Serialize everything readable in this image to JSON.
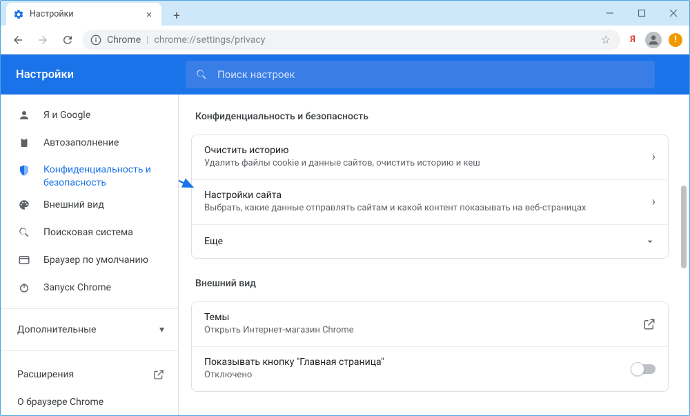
{
  "window": {
    "tab_title": "Настройки",
    "omnibox_label": "Chrome",
    "omnibox_url": "chrome://settings/privacy"
  },
  "header": {
    "title": "Настройки",
    "search_placeholder": "Поиск настроек"
  },
  "sidebar": {
    "items": [
      {
        "label": "Я и Google",
        "icon": "person-icon"
      },
      {
        "label": "Автозаполнение",
        "icon": "clipboard-icon"
      },
      {
        "label": "Конфиденциальность и безопасность",
        "icon": "shield-icon",
        "active": true
      },
      {
        "label": "Внешний вид",
        "icon": "palette-icon"
      },
      {
        "label": "Поисковая система",
        "icon": "search-icon"
      },
      {
        "label": "Браузер по умолчанию",
        "icon": "browser-icon"
      },
      {
        "label": "Запуск Chrome",
        "icon": "power-icon"
      }
    ],
    "advanced_label": "Дополнительные",
    "extensions_label": "Расширения",
    "about_label": "О браузере Chrome"
  },
  "sections": {
    "privacy": {
      "title": "Конфиденциальность и безопасность",
      "rows": [
        {
          "title": "Очистить историю",
          "sub": "Удалить файлы cookie и данные сайтов, очистить историю и кеш",
          "action": "chevron"
        },
        {
          "title": "Настройки сайта",
          "sub": "Выбрать, какие данные отправлять сайтам и какой контент показывать на веб-страницах",
          "action": "chevron"
        },
        {
          "title": "Еще",
          "sub": "",
          "action": "expand"
        }
      ]
    },
    "appearance": {
      "title": "Внешний вид",
      "rows": [
        {
          "title": "Темы",
          "sub": "Открыть Интернет-магазин Chrome",
          "action": "open-external"
        },
        {
          "title": "Показывать кнопку \"Главная страница\"",
          "sub": "Отключено",
          "action": "toggle"
        }
      ]
    }
  }
}
